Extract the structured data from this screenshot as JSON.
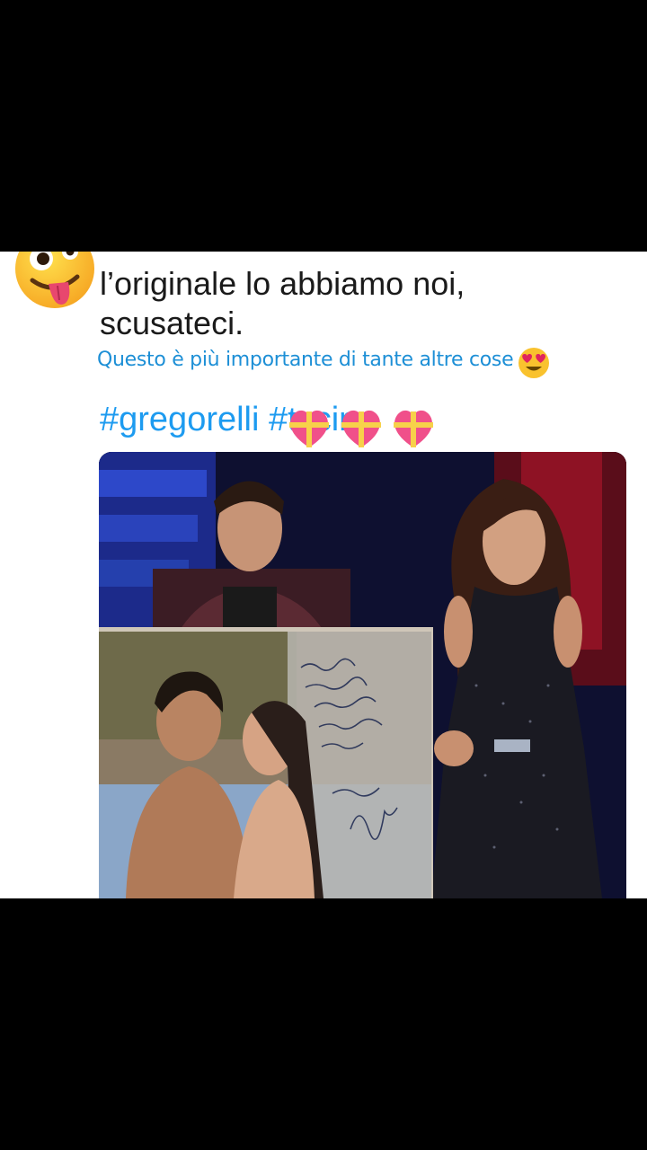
{
  "post": {
    "author_fragment": "",
    "text_line1": "l’originale lo abbiamo noi,",
    "text_line2": "scusateci.",
    "story_caption": "Questo è più importante di tante altre cose",
    "hashtag_main": "#gregorelli",
    "hashtag_second": "#tzcin"
  },
  "emojis": {
    "face": "zany-face-emoji",
    "caption_emoji": "heart-eyes-emoji",
    "hearts": "gift-heart-emoji"
  },
  "photo": {
    "description_icon": "photo-image",
    "handwritten_note": "Ciao Pierpi questa foto ti troverà ... È stato il nostro ... la nostra storia ... Alla tua maglia ... G"
  },
  "colors": {
    "background": "#000000",
    "card": "#ffffff",
    "link_blue": "#1d9bf0",
    "caption_blue": "#1d8fd6"
  }
}
